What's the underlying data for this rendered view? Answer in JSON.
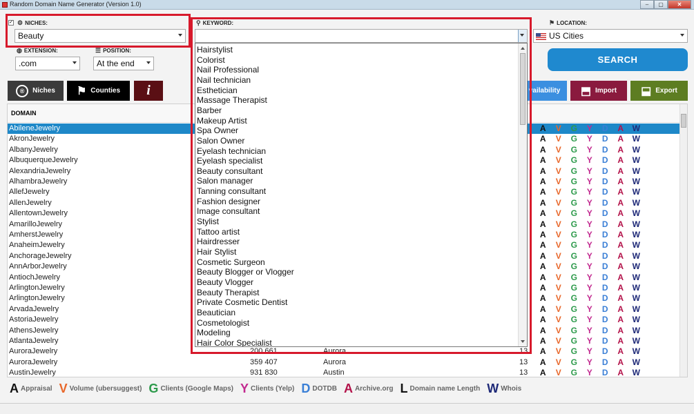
{
  "window": {
    "title": "Random Domain Name Generator (Version 1.0)"
  },
  "niches": {
    "label": "NICHES:",
    "checked": "✓",
    "value": "Beauty"
  },
  "keyword": {
    "label": "KEYWORD:",
    "value": ""
  },
  "location": {
    "label": "LOCATION:",
    "value": "US Cities"
  },
  "extension": {
    "label": "EXTENSION:",
    "value": ".com"
  },
  "position": {
    "label": "POSITION:",
    "value": "At the end"
  },
  "search_label": "SEARCH",
  "toolbar": {
    "niches_label": "Niches",
    "counties_label": "Counties",
    "info_label": "i",
    "availability_label": "vailability",
    "import_label": "Import",
    "export_label": "Export"
  },
  "grid": {
    "domain_header": "DOMAIN",
    "icon_letters": [
      "A",
      "V",
      "G",
      "Y",
      "D",
      "A",
      "W"
    ],
    "rows": [
      {
        "domain": "AbileneJewelry",
        "num": "",
        "city": "",
        "len": ""
      },
      {
        "domain": "AkronJewelry",
        "num": "",
        "city": "",
        "len": ""
      },
      {
        "domain": "AlbanyJewelry",
        "num": "",
        "city": "",
        "len": ""
      },
      {
        "domain": "AlbuquerqueJewelry",
        "num": "",
        "city": "",
        "len": ""
      },
      {
        "domain": "AlexandriaJewelry",
        "num": "",
        "city": "",
        "len": ""
      },
      {
        "domain": "AlhambraJewelry",
        "num": "",
        "city": "",
        "len": ""
      },
      {
        "domain": "AllefJewelry",
        "num": "",
        "city": "",
        "len": ""
      },
      {
        "domain": "AllenJewelry",
        "num": "",
        "city": "",
        "len": ""
      },
      {
        "domain": "AllentownJewelry",
        "num": "",
        "city": "",
        "len": ""
      },
      {
        "domain": "AmarilloJewelry",
        "num": "",
        "city": "",
        "len": ""
      },
      {
        "domain": "AmherstJewelry",
        "num": "",
        "city": "",
        "len": ""
      },
      {
        "domain": "AnaheimJewelry",
        "num": "",
        "city": "",
        "len": ""
      },
      {
        "domain": "AnchorageJewelry",
        "num": "",
        "city": "",
        "len": ""
      },
      {
        "domain": "AnnArborJewelry",
        "num": "",
        "city": "",
        "len": ""
      },
      {
        "domain": "AntiochJewelry",
        "num": "",
        "city": "",
        "len": ""
      },
      {
        "domain": "ArlingtonJewelry",
        "num": "",
        "city": "",
        "len": ""
      },
      {
        "domain": "ArlingtonJewelry",
        "num": "",
        "city": "",
        "len": ""
      },
      {
        "domain": "ArvadaJewelry",
        "num": "",
        "city": "",
        "len": ""
      },
      {
        "domain": "AstoriaJewelry",
        "num": "",
        "city": "",
        "len": ""
      },
      {
        "domain": "AthensJewelry",
        "num": "",
        "city": "",
        "len": ""
      },
      {
        "domain": "AtlantaJewelry",
        "num": "",
        "city": "",
        "len": ""
      },
      {
        "domain": "AuroraJewelry",
        "num": "200 661",
        "city": "Aurora",
        "len": "13"
      },
      {
        "domain": "AuroraJewelry",
        "num": "359 407",
        "city": "Aurora",
        "len": "13"
      },
      {
        "domain": "AustinJewelry",
        "num": "931 830",
        "city": "Austin",
        "len": "13"
      }
    ]
  },
  "dropdown_items": [
    "Hairstylist",
    "Colorist",
    "Nail Professional",
    "Nail technician",
    "Esthetician",
    "Massage Therapist",
    "Barber",
    "Makeup Artist",
    "Spa Owner",
    "Salon Owner",
    "Eyelash technician",
    "Eyelash specialist",
    "Beauty consultant",
    "Salon manager",
    "Tanning consultant",
    "Fashion designer",
    "Image consultant",
    "Stylist",
    "Tattoo artist",
    "Hairdresser",
    "Hair Stylist",
    "Cosmetic Surgeon",
    "Beauty Blogger or Vlogger",
    "Beauty Vlogger",
    "Beauty Therapist",
    "Private Cosmetic Dentist",
    "Beautician",
    "Cosmetologist",
    "Modeling",
    "Hair Color Specialist"
  ],
  "legend": [
    {
      "key": "A",
      "label": "Appraisal",
      "color": "#111111"
    },
    {
      "key": "V",
      "label": "Volume (ubersuggest)",
      "color": "#e8672a"
    },
    {
      "key": "G",
      "label": "Clients (Google Maps)",
      "color": "#2d9a4b"
    },
    {
      "key": "Y",
      "label": "Clients (Yelp)",
      "color": "#c2298f"
    },
    {
      "key": "D",
      "label": "DOTDB",
      "color": "#3a7fd6"
    },
    {
      "key": "A",
      "label": "Archive.org",
      "color": "#b3124a"
    },
    {
      "key": "L",
      "label": "Domain name Length",
      "color": "#111111"
    },
    {
      "key": "W",
      "label": "Whois",
      "color": "#1f2a78"
    }
  ],
  "colors": {
    "icon_letters": [
      "#111111",
      "#e8672a",
      "#2d9a4b",
      "#c2298f",
      "#3a7fd6",
      "#b3124a",
      "#1f2a78"
    ],
    "search": "#1f89cf",
    "selection": "#1e88c8",
    "highlight_box": "#d7192b"
  },
  "icons": {
    "niches": "gear-icon",
    "keyword": "magnifier-icon",
    "location": "pin-icon",
    "extension": "globe-icon",
    "position": "list-icon",
    "flag": "us-flag-icon"
  }
}
